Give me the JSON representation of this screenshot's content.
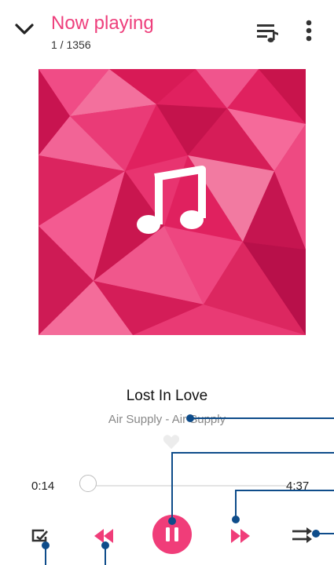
{
  "header": {
    "title": "Now playing",
    "track_position": "1 / 1356"
  },
  "song": {
    "title": "Lost In Love",
    "artist_album": "Air Supply - Air Supply"
  },
  "progress": {
    "elapsed": "0:14",
    "total": "4:37",
    "fraction": 0.05
  },
  "colors": {
    "accent": "#ee3f7c",
    "annotation": "#0e4c8a"
  },
  "icons": [
    "chevron-down-icon",
    "queue-icon",
    "more-vert-icon",
    "music-note-icon",
    "heart-icon",
    "repeat-icon",
    "rewind-icon",
    "pause-icon",
    "fast-forward-icon",
    "shuffle-icon"
  ]
}
